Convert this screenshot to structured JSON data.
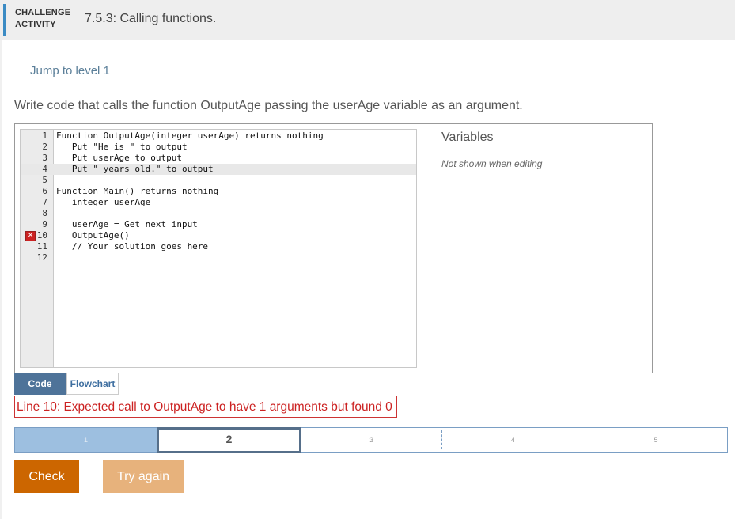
{
  "header": {
    "label_line1": "CHALLENGE",
    "label_line2": "ACTIVITY",
    "title": "7.5.3: Calling functions.",
    "accent_color": "#3b8bc4"
  },
  "jump_link": "Jump to level 1",
  "prompt": "Write code that calls the function OutputAge passing the userAge variable as an argument.",
  "code": {
    "lines": [
      {
        "num": "1",
        "text": "Function OutputAge(integer userAge) returns nothing"
      },
      {
        "num": "2",
        "text": "   Put \"He is \" to output"
      },
      {
        "num": "3",
        "text": "   Put userAge to output"
      },
      {
        "num": "4",
        "text": "   Put \" years old.\" to output"
      },
      {
        "num": "5",
        "text": ""
      },
      {
        "num": "6",
        "text": "Function Main() returns nothing"
      },
      {
        "num": "7",
        "text": "   integer userAge"
      },
      {
        "num": "8",
        "text": ""
      },
      {
        "num": "9",
        "text": "   userAge = Get next input"
      },
      {
        "num": "10",
        "text": "   OutputAge()"
      },
      {
        "num": "11",
        "text": "   // Your solution goes here"
      },
      {
        "num": "12",
        "text": ""
      }
    ],
    "error_line": "10",
    "error_icon": "error-x-icon"
  },
  "variables": {
    "title": "Variables",
    "note": "Not shown when editing"
  },
  "tabs": {
    "code": "Code",
    "flowchart": "Flowchart",
    "active": "Code"
  },
  "error_message": "Line 10: Expected call to OutputAge to have 1 arguments but found 0",
  "levels": {
    "items": [
      "1",
      "2",
      "3",
      "4",
      "5"
    ],
    "completed": [
      "1"
    ],
    "current": "2"
  },
  "buttons": {
    "check": "Check",
    "try_again": "Try again"
  },
  "colors": {
    "check_button": "#cc6600",
    "try_again_button": "#e7b27c",
    "error": "#cc2222",
    "level_done": "#9dbfe0",
    "tab_active": "#4e7399"
  }
}
